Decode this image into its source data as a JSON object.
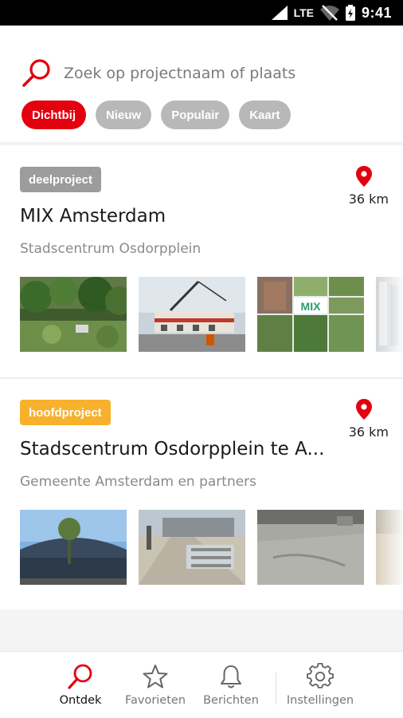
{
  "status_bar": {
    "network": "LTE",
    "time": "9:41"
  },
  "search": {
    "placeholder": "Zoek op projectnaam of plaats"
  },
  "filters": [
    {
      "label": "Dichtbij",
      "active": true
    },
    {
      "label": "Nieuw",
      "active": false
    },
    {
      "label": "Populair",
      "active": false
    },
    {
      "label": "Kaart",
      "active": false
    }
  ],
  "projects": [
    {
      "badge": "deelproject",
      "badge_color": "#9c9c9c",
      "distance": "36 km",
      "title": "MIX Amsterdam",
      "subtitle": "Stadscentrum Osdorpplein",
      "photos": [
        "garden-photo",
        "construction-crane-photo",
        "mix-collage-photo",
        "building-facade-photo"
      ],
      "collage_text": "MIX"
    },
    {
      "badge": "hoofdproject",
      "badge_color": "#f7b12d",
      "distance": "36 km",
      "title": "Stadscentrum Osdorpplein te A...",
      "subtitle": "Gemeente Amsterdam en partners",
      "photos": [
        "station-roof-photo",
        "street-works-photo",
        "paved-square-photo",
        "sandy-ground-photo"
      ]
    }
  ],
  "bottom_nav": [
    {
      "label": "Ontdek",
      "icon": "search-icon",
      "active": true
    },
    {
      "label": "Favorieten",
      "icon": "star-icon",
      "active": false
    },
    {
      "label": "Berichten",
      "icon": "bell-icon",
      "active": false
    },
    {
      "label": "Instellingen",
      "icon": "gear-icon",
      "active": false
    }
  ],
  "colors": {
    "accent": "#e3000f",
    "chip_inactive": "#b8b8b8"
  }
}
